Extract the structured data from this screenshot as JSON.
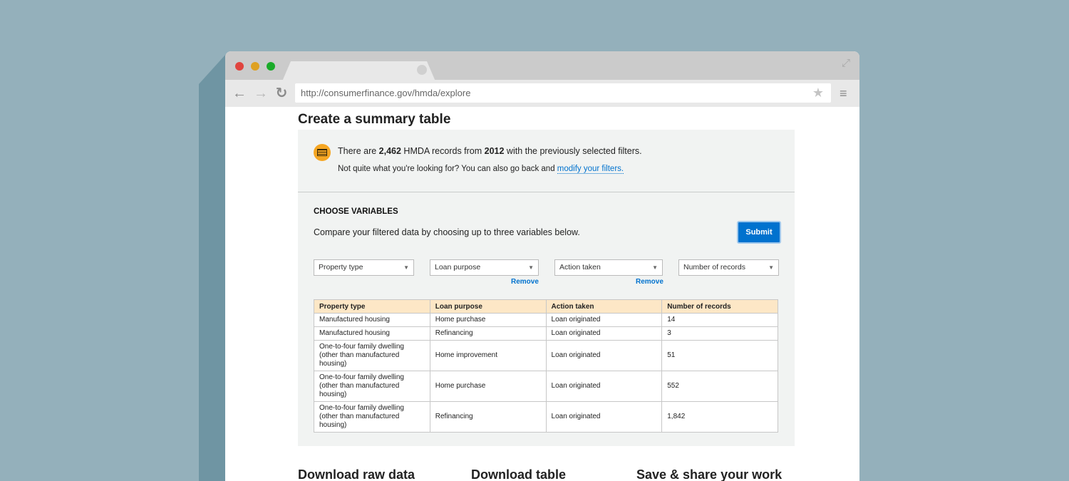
{
  "browser": {
    "url": "http://consumerfinance.gov/hmda/explore",
    "buttons": {
      "back": "←",
      "forward": "→",
      "reload": "↻",
      "star": "★",
      "menu": "≡",
      "expand": "⤢"
    }
  },
  "page": {
    "title": "Create a summary table"
  },
  "info": {
    "prefix": "There are ",
    "record_count": "2,462",
    "middle": " HMDA records from ",
    "year": "2012",
    "suffix": " with the previously selected filters.",
    "line2_text": "Not quite what you're looking for? You can also go back and ",
    "line2_link": "modify your filters."
  },
  "variables": {
    "heading": "CHOOSE VARIABLES",
    "description": "Compare your filtered data by choosing up to three variables below.",
    "submit_label": "Submit",
    "selects": [
      "Property type",
      "Loan purpose",
      "Action taken",
      "Number of records"
    ],
    "remove_label": "Remove"
  },
  "table": {
    "headers": [
      "Property type",
      "Loan purpose",
      "Action taken",
      "Number of records"
    ],
    "rows": [
      [
        "Manufactured housing",
        "Home purchase",
        "Loan originated",
        "14"
      ],
      [
        "Manufactured housing",
        "Refinancing",
        "Loan originated",
        "3"
      ],
      [
        "One-to-four family dwelling (other than manufactured housing)",
        "Home improvement",
        "Loan originated",
        "51"
      ],
      [
        "One-to-four family dwelling (other than manufactured housing)",
        "Home purchase",
        "Loan originated",
        "552"
      ],
      [
        "One-to-four family dwelling (other than manufactured housing)",
        "Refinancing",
        "Loan originated",
        "1,842"
      ]
    ]
  },
  "bottom": {
    "download_raw": "Download raw data",
    "download_table": "Download table",
    "save_share": "Save & share your work"
  },
  "colors": {
    "background": "#94b0bb",
    "accent": "#0072ce",
    "table_header": "#fde7c6",
    "icon": "#f5a623"
  }
}
